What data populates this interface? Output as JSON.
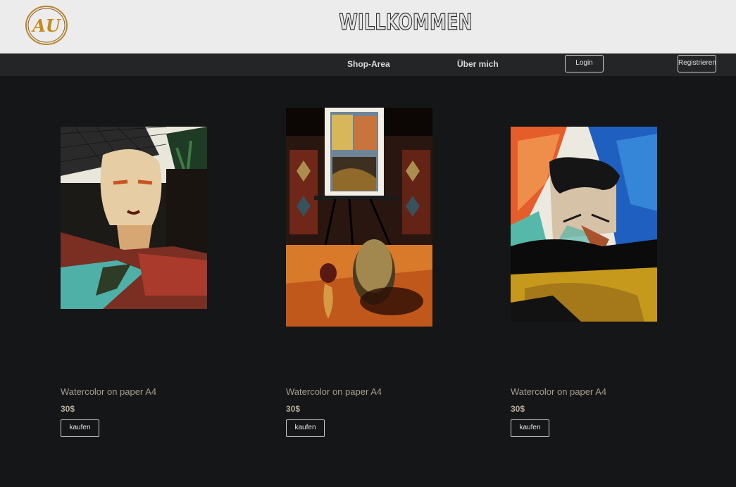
{
  "header": {
    "title": "WILLKOMMEN",
    "logo_text": "AU"
  },
  "nav": {
    "shop": "Shop-Area",
    "about": "Über mich",
    "login": "Login",
    "register": "Registrieren"
  },
  "products": [
    {
      "title": "Watercolor on paper A4",
      "price": "30$",
      "buy": "kaufen"
    },
    {
      "title": "Watercolor on paper A4",
      "price": "30$",
      "buy": "kaufen"
    },
    {
      "title": "Watercolor on paper A4",
      "price": "30$",
      "buy": "kaufen"
    }
  ],
  "colors": {
    "header_bg": "#ececec",
    "nav_bg": "#242527",
    "page_bg": "#151618",
    "caption": "#a89d8d"
  }
}
